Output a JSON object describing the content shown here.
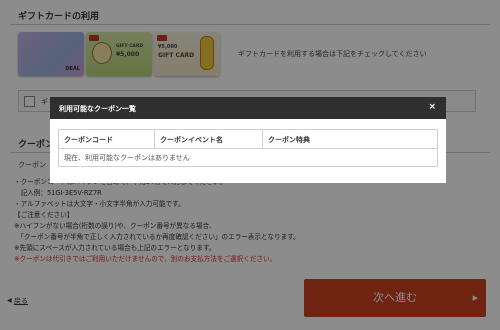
{
  "giftcard": {
    "section_title": "ギフトカードの利用",
    "cards": [
      {
        "label": "DEAL"
      },
      {
        "label": "GIFT CARD",
        "amount": "¥5,000"
      },
      {
        "label": "GIFT CARD",
        "amount": "¥5,000"
      }
    ],
    "note": "ギフトカードを利用する場合は下記をチェックしてください",
    "checkbox_text": "ギ"
  },
  "coupon": {
    "section_title": "クーポン",
    "label": "クーポン",
    "notes": [
      "・クーポンコードはハイフンを含めて、半角14桁で入力してください。",
      "　記入例：51GI-3E5V-RZ7R",
      "・アルファベットは大文字・小文字半角が入力可能です。",
      "【ご注意ください】",
      "※ハイフンがない場合(桁数の誤り)や、クーポン番号が異なる場合、",
      "　「クーポン番号が半角で正しく入力されているか再度確認ください」のエラー表示となります。",
      "※先頭にスペースが入力されている場合も上記のエラーとなります。"
    ],
    "warning": "※クーポンは代引きではご利用いただけませんので、別のお支払方法をご選択ください。"
  },
  "nav": {
    "back_label": "戻る",
    "back_arrow": "◀",
    "next_label": "次へ進む",
    "next_arrow": "▶"
  },
  "modal": {
    "title": "利用可能なクーポン一覧",
    "close": "×",
    "columns": [
      "クーポンコード",
      "クーポンイベント名",
      "クーポン特典"
    ],
    "empty_message": "現在、利用可能なクーポンはありません"
  },
  "colors": {
    "accent": "#c8431e",
    "modal_header": "#2f2f2f",
    "section_line": "#b7d8cf",
    "warning": "#d0301f"
  }
}
